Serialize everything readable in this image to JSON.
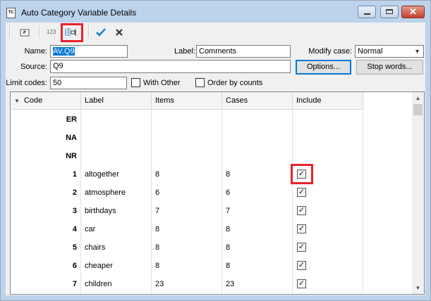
{
  "window": {
    "title": "Auto Category Variable Details",
    "app_icon_text": "TC"
  },
  "toolbar": {
    "numbering_label": "123",
    "accent": "#0c7bd4",
    "highlight_color": "#e8232a"
  },
  "form": {
    "name_label": "Name:",
    "name_value": "AV.Q9",
    "label_label": "Label:",
    "label_value": "Comments",
    "modify_case_label": "Modify case:",
    "modify_case_value": "Normal",
    "source_label": "Source:",
    "source_value": "Q9",
    "options_button": "Options...",
    "stop_words_button": "Stop words...",
    "limit_codes_label": "Limit codes:",
    "limit_codes_value": "50",
    "with_other_label": "With Other",
    "order_by_counts_label": "Order by counts"
  },
  "grid": {
    "columns": [
      "Code",
      "Label",
      "Items",
      "Cases",
      "Include"
    ],
    "rows": [
      {
        "code": "ER",
        "label": "",
        "items": "",
        "cases": "",
        "include": null
      },
      {
        "code": "NA",
        "label": "",
        "items": "",
        "cases": "",
        "include": null
      },
      {
        "code": "NR",
        "label": "",
        "items": "",
        "cases": "",
        "include": null
      },
      {
        "code": "1",
        "label": "altogether",
        "items": "8",
        "cases": "8",
        "include": true
      },
      {
        "code": "2",
        "label": "atmosphere",
        "items": "6",
        "cases": "6",
        "include": true
      },
      {
        "code": "3",
        "label": "birthdays",
        "items": "7",
        "cases": "7",
        "include": true
      },
      {
        "code": "4",
        "label": "car",
        "items": "8",
        "cases": "8",
        "include": true
      },
      {
        "code": "5",
        "label": "chairs",
        "items": "8",
        "cases": "8",
        "include": true
      },
      {
        "code": "6",
        "label": "cheaper",
        "items": "8",
        "cases": "8",
        "include": true
      },
      {
        "code": "7",
        "label": "children",
        "items": "23",
        "cases": "23",
        "include": true
      }
    ]
  }
}
